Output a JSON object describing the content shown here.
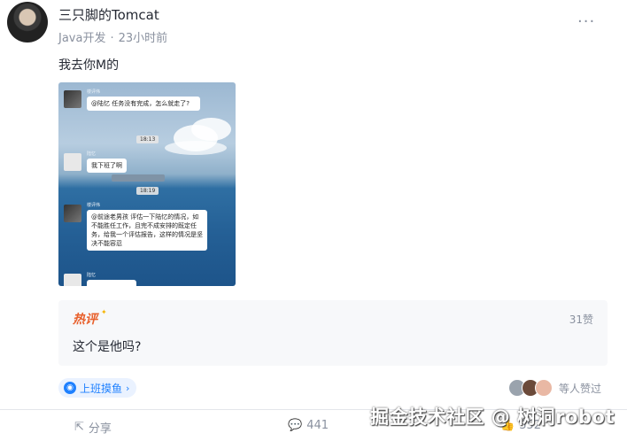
{
  "post": {
    "author": "三只脚的Tomcat",
    "category": "Java开发",
    "separator": "·",
    "time": "23小时前",
    "more_icon": "more-dots-icon",
    "text": "我去你M的"
  },
  "screenshot": {
    "msg1_name": "楼评伟",
    "msg1_text": "@陆忆 任务没有完成，怎么就走了?",
    "time1": "18:13",
    "msg2_name": "陆忆",
    "msg2_text": "我下班了啊",
    "time2": "18:19",
    "msg3_name": "楼评伟",
    "msg3_text": "@前途老男孩 评估一下陆忆的情况，如不能胜任工作，且完不成安排的既定任务，给我一个评估报告，这样的情况是坚决不能容忍",
    "msg4_name": "陆忆"
  },
  "hot_comment": {
    "label": "热评",
    "likes": "31赞",
    "text": "这个是他吗?"
  },
  "topic": {
    "label": "上班摸鱼",
    "chevron": "›"
  },
  "likers": {
    "text": "等人赞过",
    "avatar_colors": [
      "#9aa3ad",
      "#6b4a3a",
      "#e9b8a4"
    ]
  },
  "actions": {
    "share": "分享",
    "comments": "441",
    "likes": "352"
  },
  "watermark": "掘金技术社区 @ 树洞robot"
}
